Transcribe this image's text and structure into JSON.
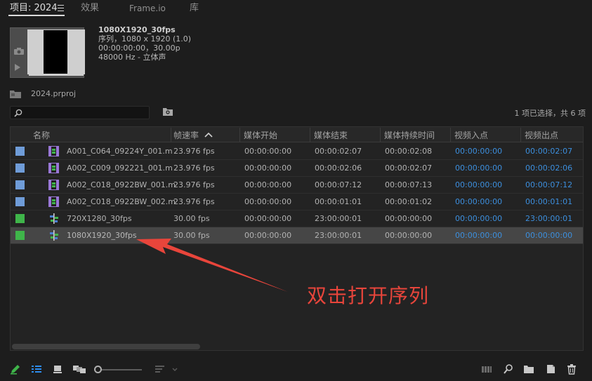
{
  "tabs": [
    {
      "label": "项目: 2024"
    },
    {
      "label": "效果"
    },
    {
      "label": "Frame.io"
    },
    {
      "label": "库"
    }
  ],
  "preview": {
    "title": "1080X1920_30fps",
    "line2": "序列，1080 x 1920 (1.0)",
    "line3": "00:00:00:00，30.00p",
    "line4": "48000 Hz - 立体声"
  },
  "project_file": "2024.prproj",
  "search": {
    "placeholder": ""
  },
  "selection_status": "1 项已选择，共 6 项",
  "columns": [
    "名称",
    "帧速率",
    "媒体开始",
    "媒体结束",
    "媒体持续时间",
    "视频入点",
    "视频出点"
  ],
  "rows": [
    {
      "name": "A001_C064_09224Y_001.m",
      "fps": "23.976 fps",
      "start": "00:00:00:00",
      "end": "00:00:02:07",
      "duration": "00:00:02:08",
      "in": "00:00:00:00",
      "out": "00:00:02:07",
      "color": "#6f9cd8",
      "icon": "clip-icon"
    },
    {
      "name": "A002_C009_092221_001.m",
      "fps": "23.976 fps",
      "start": "00:00:00:00",
      "end": "00:00:02:06",
      "duration": "00:00:02:07",
      "in": "00:00:00:00",
      "out": "00:00:02:06",
      "color": "#6f9cd8",
      "icon": "clip-icon"
    },
    {
      "name": "A002_C018_0922BW_001.m",
      "fps": "23.976 fps",
      "start": "00:00:00:00",
      "end": "00:00:07:12",
      "duration": "00:00:07:13",
      "in": "00:00:00:00",
      "out": "00:00:07:12",
      "color": "#6f9cd8",
      "icon": "clip-icon"
    },
    {
      "name": "A002_C018_0922BW_002.m",
      "fps": "23.976 fps",
      "start": "00:00:00:00",
      "end": "00:00:01:01",
      "duration": "00:00:01:02",
      "in": "00:00:00:00",
      "out": "00:00:01:01",
      "color": "#6f9cd8",
      "icon": "clip-icon"
    },
    {
      "name": "720X1280_30fps",
      "fps": "30.00 fps",
      "start": "00:00:00:00",
      "end": "23:00:00:01",
      "duration": "00:00:00:00",
      "in": "00:00:00:00",
      "out": "23:00:00:01",
      "color": "#3fb54a",
      "icon": "sequence-icon"
    },
    {
      "name": "1080X1920_30fps",
      "fps": "30.00 fps",
      "start": "00:00:00:00",
      "end": "23:00:00:01",
      "duration": "00:00:00:00",
      "in": "00:00:00:00",
      "out": "00:00:00:00",
      "color": "#3fb54a",
      "icon": "sequence-icon",
      "selected": true
    }
  ],
  "annotation": "双击打开序列",
  "colors": {
    "timecode_blue": "#3c8fde",
    "annotation_red": "#e8453b",
    "accent_blue": "#2d8ceb"
  }
}
